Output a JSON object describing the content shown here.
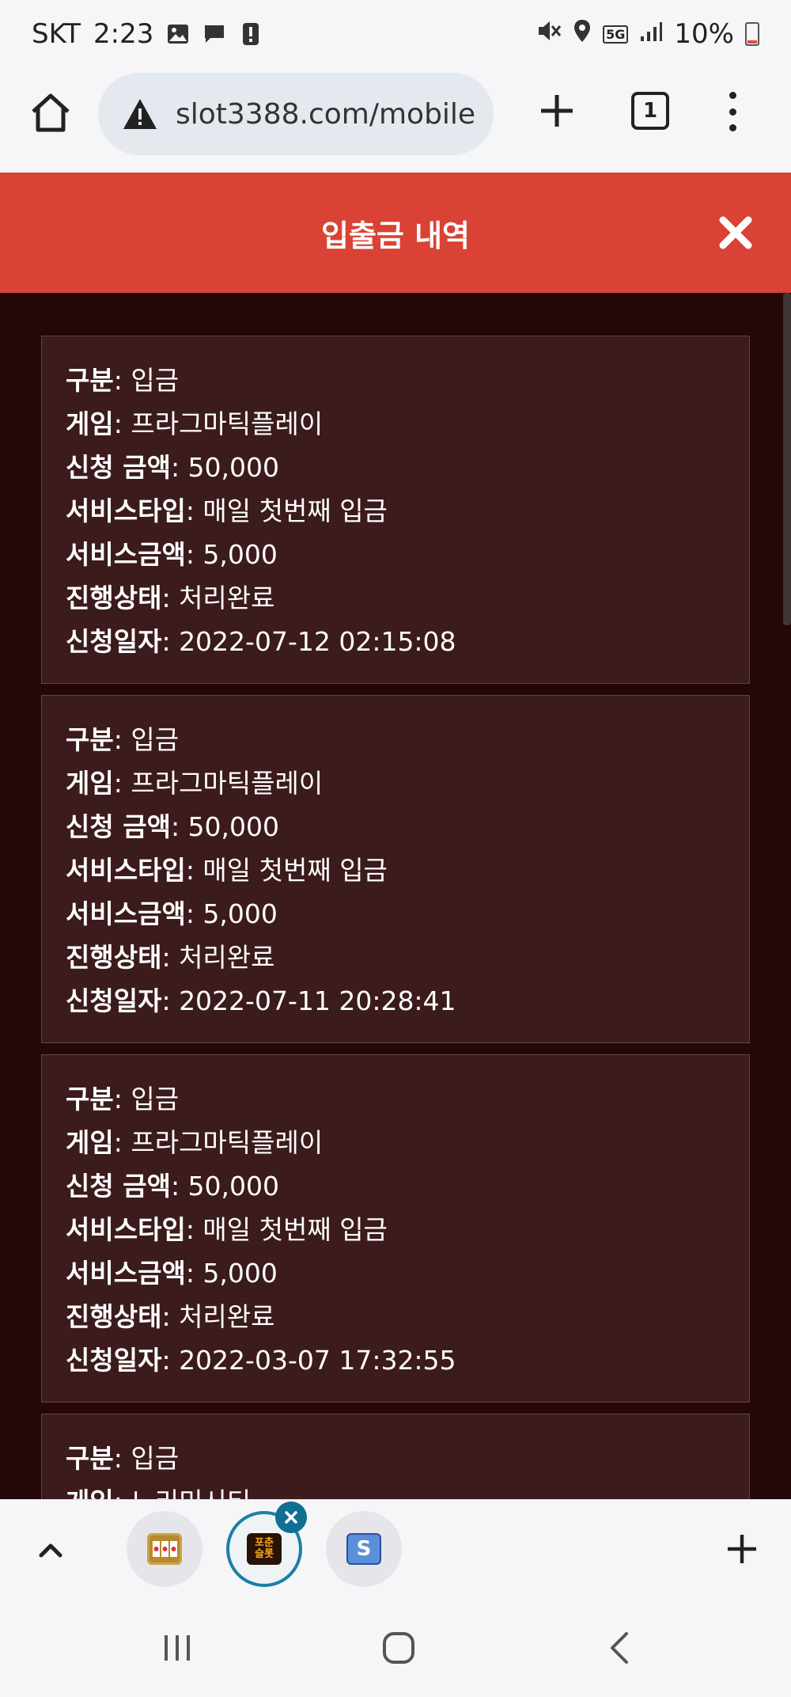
{
  "status_bar": {
    "carrier": "SKT",
    "time": "2:23",
    "network": "5G",
    "battery": "10%"
  },
  "browser": {
    "url": "slot3388.com/mobile",
    "tab_count": "1"
  },
  "modal": {
    "title": "입출금 내역"
  },
  "labels": {
    "type": "구분",
    "game": "게임",
    "amount": "신청 금액",
    "service_type": "서비스타입",
    "service_amount": "서비스금액",
    "status": "진행상태",
    "date": "신청일자"
  },
  "records": [
    {
      "type": "입금",
      "game": "프라그마틱플레이",
      "amount": "50,000",
      "service_type": "매일 첫번째 입금",
      "service_amount": "5,000",
      "status": "처리완료",
      "date": "2022-07-12 02:15:08"
    },
    {
      "type": "입금",
      "game": "프라그마틱플레이",
      "amount": "50,000",
      "service_type": "매일 첫번째 입금",
      "service_amount": "5,000",
      "status": "처리완료",
      "date": "2022-07-11 20:28:41"
    },
    {
      "type": "입금",
      "game": "프라그마틱플레이",
      "amount": "50,000",
      "service_type": "매일 첫번째 입금",
      "service_amount": "5,000",
      "status": "처리완료",
      "date": "2022-03-07 17:32:55"
    },
    {
      "type": "입금",
      "game": "노리밋시티",
      "amount": "",
      "service_type": "",
      "service_amount": "",
      "status": "",
      "date": ""
    }
  ],
  "bottom_tabs": {
    "active_thumb_label": "포춘\n슬롯",
    "third_thumb_label": "S"
  },
  "colors": {
    "header_red": "#d94234",
    "page_bg": "#240707",
    "card_bg": "#3c1b1c",
    "active_tab_ring": "#1c7fa4"
  }
}
